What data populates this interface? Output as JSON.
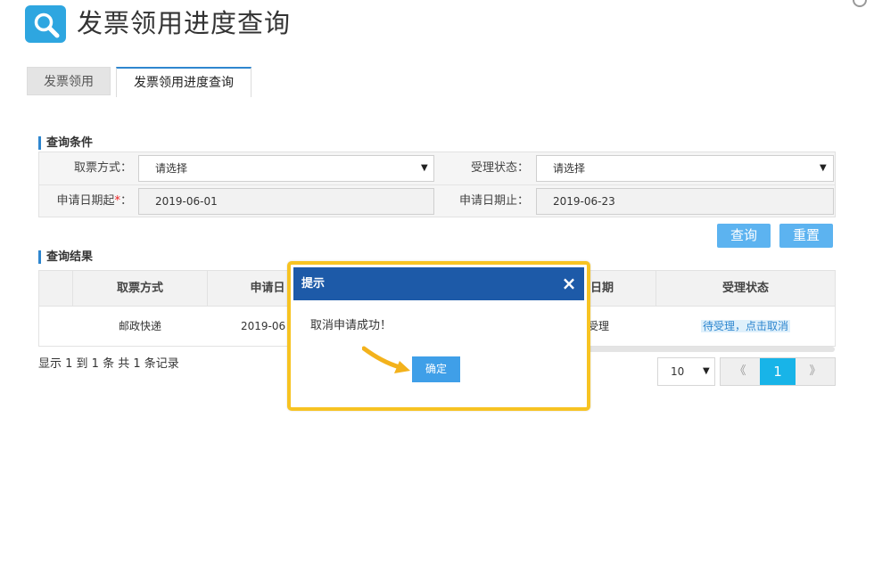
{
  "header": {
    "title": "发票领用进度查询"
  },
  "tabs": [
    {
      "label": "发票领用"
    },
    {
      "label": "发票领用进度查询"
    }
  ],
  "query": {
    "section_title": "查询条件",
    "method_label": "取票方式：",
    "method_value": "请选择",
    "status_label": "受理状态：",
    "status_value": "请选择",
    "date_start_label": "申请日期起",
    "date_start_required": "*",
    "date_start_colon": "：",
    "date_start_value": "2019-06-01",
    "date_end_label": "申请日期止：",
    "date_end_value": "2019-06-23",
    "search_button": "查询",
    "reset_button": "重置"
  },
  "result": {
    "section_title": "查询结果",
    "columns": [
      "取票方式",
      "申请日",
      "日期",
      "受理状态"
    ],
    "rows": [
      {
        "method": "邮政快递",
        "date": "2019-06",
        "col3": "受理",
        "status": "待受理，点击取消"
      }
    ],
    "records_text": "显示 1 到 1 条 共 1 条记录"
  },
  "pagination": {
    "page_size": "10",
    "prev": "《",
    "current": "1",
    "next": "》"
  },
  "modal": {
    "title": "提示",
    "close": "×",
    "message": "取消申请成功！",
    "ok_button": "确定"
  },
  "colors": {
    "accent": "#2e86cf",
    "modal_header": "#1d5aa8",
    "highlight_frame": "#f7c322",
    "button": "#5cb3f0",
    "page_active": "#18b4e8"
  },
  "icons": {
    "logo": "search-icon",
    "close": "close-icon",
    "select_caret": "caret-down-icon",
    "annotation": "arrow-icon"
  }
}
